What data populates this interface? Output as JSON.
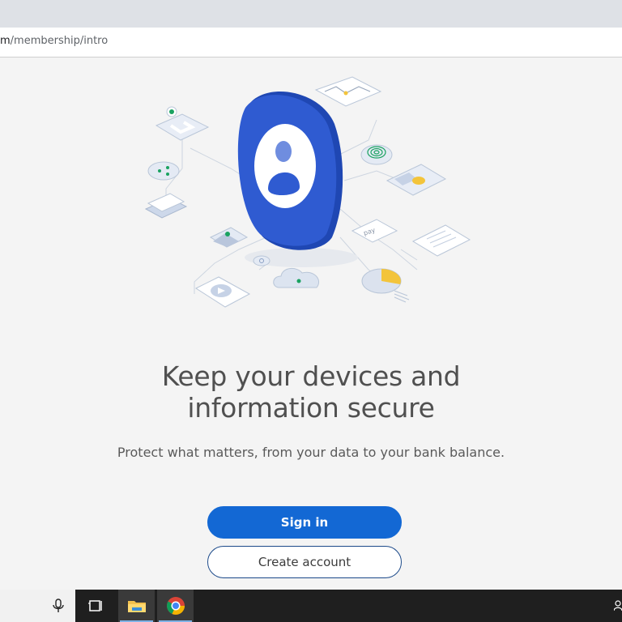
{
  "browser": {
    "url_host": "m",
    "url_path": "/membership/intro"
  },
  "hero": {
    "headline_line1": "Keep your devices and",
    "headline_line2": "information secure",
    "subtext": "Protect what matters, from your data to your bank balance.",
    "pay_label": "pay"
  },
  "actions": {
    "sign_in": "Sign in",
    "create_account": "Create account"
  },
  "colors": {
    "primary": "#1368d4",
    "account_icon_blue": "#2f5bd1",
    "accent_yellow": "#f3c43b",
    "accent_green": "#1aa260"
  },
  "taskbar": {
    "icons": [
      "microphone-icon",
      "task-view-icon",
      "file-explorer-icon",
      "chrome-icon"
    ]
  }
}
